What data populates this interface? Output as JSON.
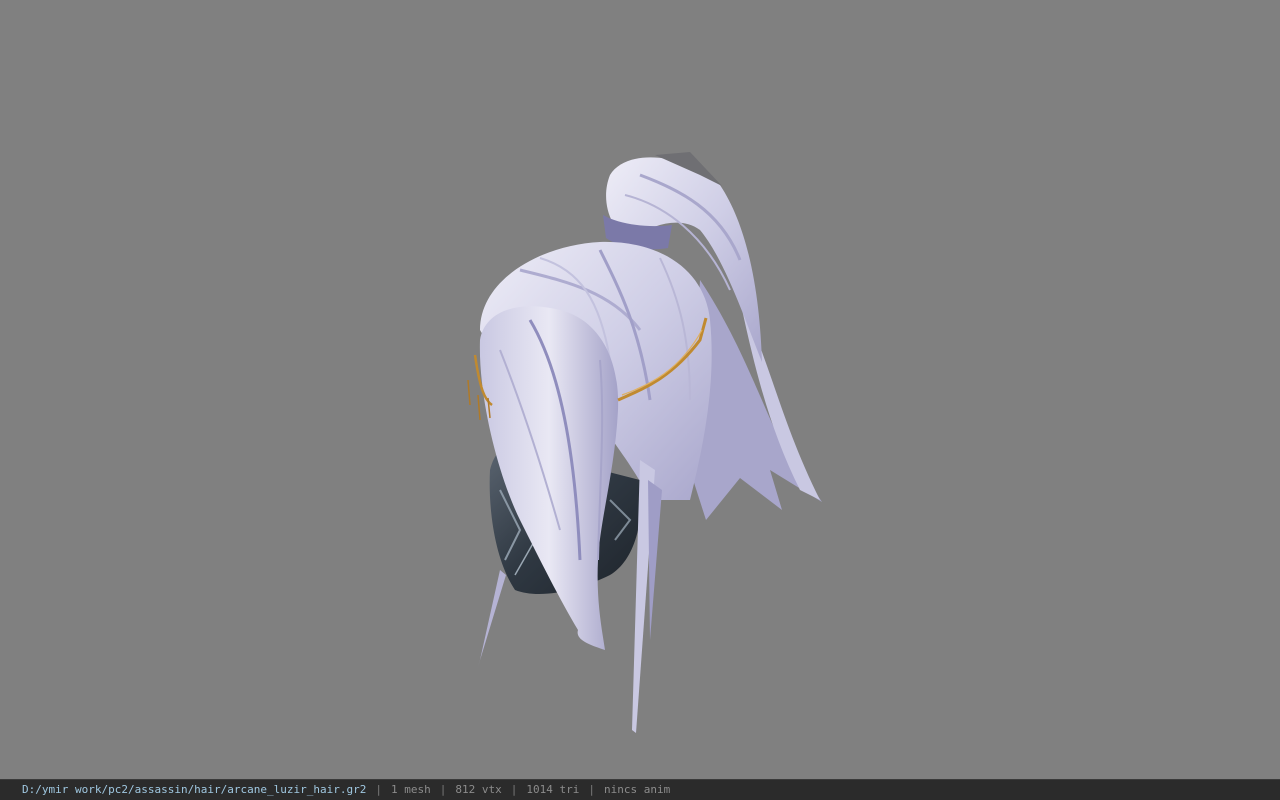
{
  "viewport": {
    "background_color": "#808080",
    "model_name": "arcane_luzir_hair",
    "model_colors": {
      "hair_light": "#e3e2f0",
      "hair_shadow": "#9a98c0",
      "hair_mid": "#c4c3dd",
      "ornament_gold": "#c08a30",
      "armor_dark": "#2d3540"
    }
  },
  "status": {
    "path": "D:/ymir work/pc2/assassin/hair/arcane_luzir_hair.gr2",
    "separator": "|",
    "mesh": "1 mesh",
    "vertices": "812 vtx",
    "triangles": "1014 tri",
    "anim": "nincs anim"
  }
}
